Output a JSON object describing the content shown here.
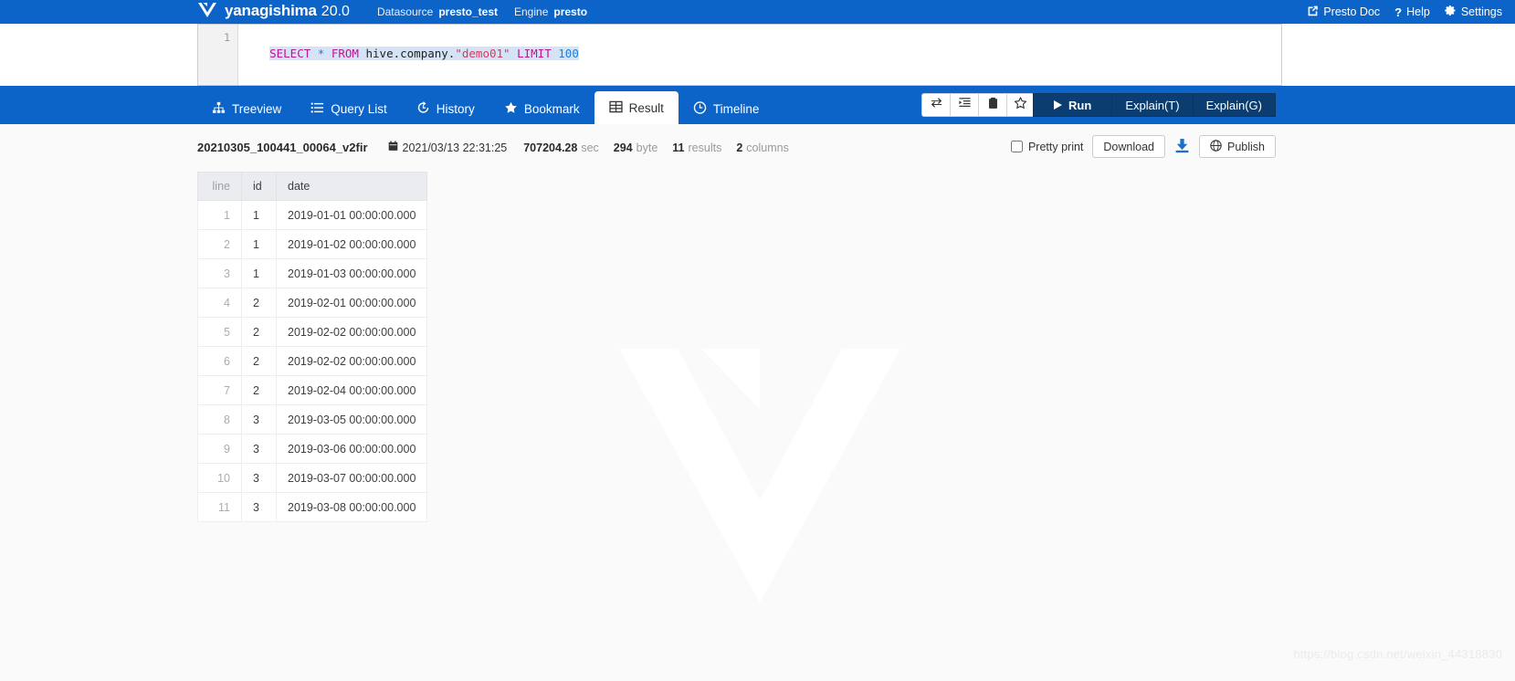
{
  "app": {
    "brand": "yanagishima",
    "version": "20.0",
    "logo_icon": "v-logo-icon"
  },
  "header": {
    "datasource_label": "Datasource",
    "datasource_value": "presto_test",
    "engine_label": "Engine",
    "engine_value": "presto",
    "nav": [
      {
        "label": "Presto Doc",
        "icon": "external-link-icon"
      },
      {
        "label": "Help",
        "icon": "question-mark-icon"
      },
      {
        "label": "Settings",
        "icon": "gear-icon"
      }
    ]
  },
  "editor": {
    "line_number": "1",
    "query_tokens": [
      {
        "text": "SELECT",
        "type": "keyword"
      },
      {
        "text": " ",
        "type": "plain"
      },
      {
        "text": "*",
        "type": "operator"
      },
      {
        "text": " ",
        "type": "plain"
      },
      {
        "text": "FROM",
        "type": "keyword"
      },
      {
        "text": " ",
        "type": "plain"
      },
      {
        "text": "hive.company.",
        "type": "identifier"
      },
      {
        "text": "\"demo01\"",
        "type": "string"
      },
      {
        "text": " ",
        "type": "plain"
      },
      {
        "text": "LIMIT",
        "type": "keyword"
      },
      {
        "text": " ",
        "type": "plain"
      },
      {
        "text": "100",
        "type": "number"
      }
    ],
    "query_text": "SELECT * FROM hive.company.\"demo01\" LIMIT 100"
  },
  "tabs": [
    {
      "label": "Treeview",
      "icon": "sitemap-icon",
      "active": false
    },
    {
      "label": "Query List",
      "icon": "list-icon",
      "active": false
    },
    {
      "label": "History",
      "icon": "history-clock-icon",
      "active": false
    },
    {
      "label": "Bookmark",
      "icon": "star-icon",
      "active": false
    },
    {
      "label": "Result",
      "icon": "table-grid-icon",
      "active": true
    },
    {
      "label": "Timeline",
      "icon": "clock-icon",
      "active": false
    }
  ],
  "toolbar": {
    "icon_buttons": [
      {
        "name": "swap-icon",
        "title": "swap"
      },
      {
        "name": "format-indent-icon",
        "title": "format"
      },
      {
        "name": "clipboard-icon",
        "title": "clipboard"
      },
      {
        "name": "star-outline-icon",
        "title": "bookmark"
      }
    ],
    "run_label": "Run",
    "run_icon": "play-icon",
    "explain_t_label": "Explain(T)",
    "explain_g_label": "Explain(G)"
  },
  "result_meta": {
    "query_id": "20210305_100441_00064_v2fir",
    "calendar_icon": "calendar-icon",
    "timestamp": "2021/03/13 22:31:25",
    "elapsed_value": "707204.28",
    "elapsed_unit": "sec",
    "size_value": "294",
    "size_unit": "byte",
    "rows_value": "11",
    "rows_unit": "results",
    "columns_value": "2",
    "columns_unit": "columns"
  },
  "result_actions": {
    "pretty_print_label": "Pretty print",
    "pretty_print_checked": false,
    "download_label": "Download",
    "download_icon": "download-icon",
    "publish_label": "Publish",
    "publish_icon": "globe-icon"
  },
  "table": {
    "columns": [
      "line",
      "id",
      "date"
    ],
    "rows": [
      [
        "1",
        "1",
        "2019-01-01 00:00:00.000"
      ],
      [
        "2",
        "1",
        "2019-01-02 00:00:00.000"
      ],
      [
        "3",
        "1",
        "2019-01-03 00:00:00.000"
      ],
      [
        "4",
        "2",
        "2019-02-01 00:00:00.000"
      ],
      [
        "5",
        "2",
        "2019-02-02 00:00:00.000"
      ],
      [
        "6",
        "2",
        "2019-02-02 00:00:00.000"
      ],
      [
        "7",
        "2",
        "2019-02-04 00:00:00.000"
      ],
      [
        "8",
        "3",
        "2019-03-05 00:00:00.000"
      ],
      [
        "9",
        "3",
        "2019-03-06 00:00:00.000"
      ],
      [
        "10",
        "3",
        "2019-03-07 00:00:00.000"
      ],
      [
        "11",
        "3",
        "2019-03-08 00:00:00.000"
      ]
    ]
  },
  "watermark": {
    "url": "https://blog.csdn.net/weixin_44318830"
  },
  "colors": {
    "brand_blue": "#0d64c8",
    "dark_blue": "#0b3d70",
    "keyword": "#c0158a",
    "string": "#d63a5e",
    "number": "#1f7fd8"
  }
}
